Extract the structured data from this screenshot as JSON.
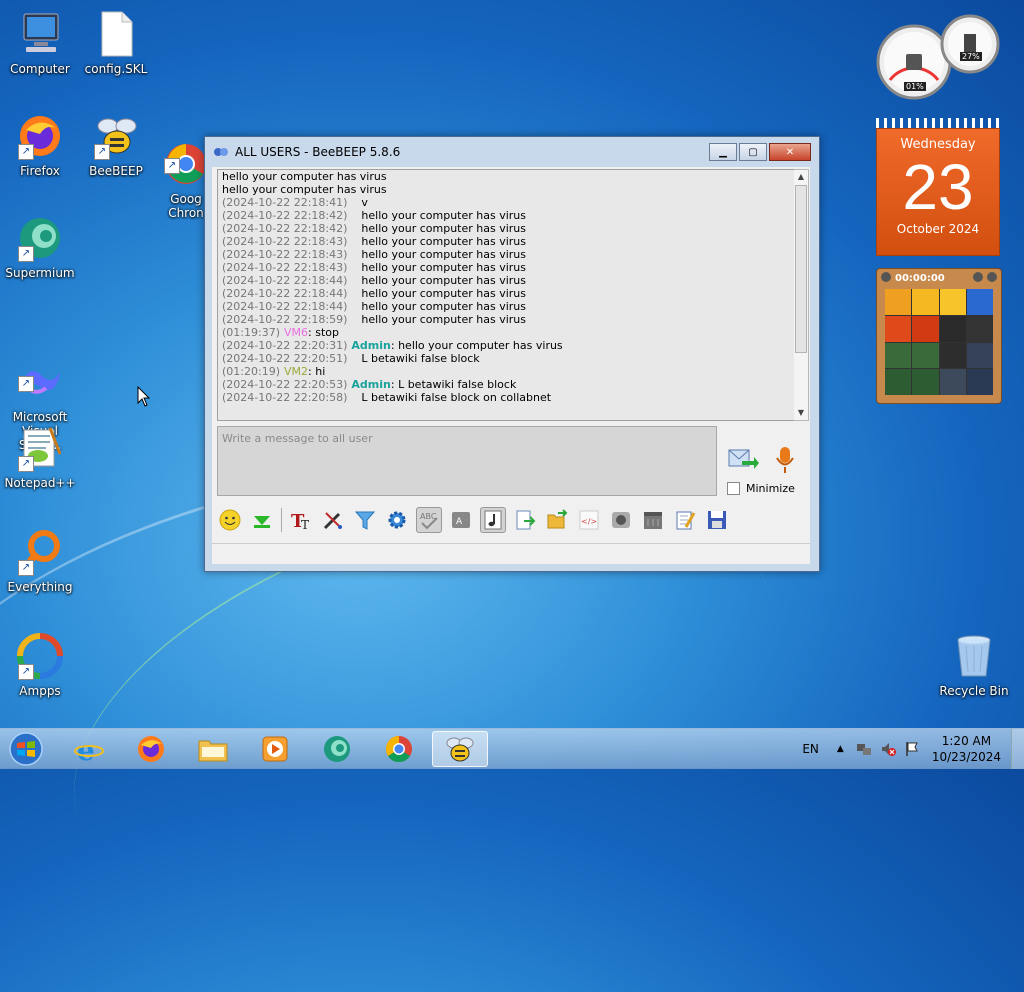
{
  "desktop": {
    "icons": [
      {
        "label": "Computer"
      },
      {
        "label": "config.SKL"
      },
      {
        "label": "Firefox"
      },
      {
        "label": "BeeBEEP"
      },
      {
        "label": "Goog\nChron"
      },
      {
        "label": "Supermium"
      },
      {
        "label": "Microsoft\nVisual Studi..."
      },
      {
        "label": "Notepad++"
      },
      {
        "label": "Everything"
      },
      {
        "label": "Ampps"
      },
      {
        "label": "Recycle Bin"
      }
    ]
  },
  "window": {
    "title": "ALL USERS - BeeBEEP 5.8.6",
    "chat_lines": [
      {
        "ts": "",
        "user": "",
        "text": "hello your computer has virus"
      },
      {
        "ts": "",
        "user": "",
        "text": "hello your computer has virus"
      },
      {
        "ts": "(2024-10-22 22:18:41)",
        "user": "",
        "text": "v"
      },
      {
        "ts": "(2024-10-22 22:18:42)",
        "user": "",
        "text": "hello your computer has virus"
      },
      {
        "ts": "(2024-10-22 22:18:42)",
        "user": "",
        "text": "hello your computer has virus"
      },
      {
        "ts": "(2024-10-22 22:18:43)",
        "user": "",
        "text": "hello your computer has virus"
      },
      {
        "ts": "(2024-10-22 22:18:43)",
        "user": "",
        "text": "hello your computer has virus"
      },
      {
        "ts": "(2024-10-22 22:18:43)",
        "user": "",
        "text": "hello your computer has virus"
      },
      {
        "ts": "(2024-10-22 22:18:44)",
        "user": "",
        "text": "hello your computer has virus"
      },
      {
        "ts": "(2024-10-22 22:18:44)",
        "user": "",
        "text": "hello your computer has virus"
      },
      {
        "ts": "(2024-10-22 22:18:44)",
        "user": "",
        "text": "hello your computer has virus"
      },
      {
        "ts": "(2024-10-22 22:18:59)",
        "user": "",
        "text": "hello your computer has virus"
      },
      {
        "ts": "(01:19:37)",
        "user": "VM6",
        "userclass": "u-vm6",
        "text": ": stop"
      },
      {
        "ts": "(2024-10-22 22:20:31)",
        "user": "Admin",
        "userclass": "u-admin",
        "text": ": hello your computer has virus"
      },
      {
        "ts": "(2024-10-22 22:20:51)",
        "user": "",
        "text": "L betawiki false block"
      },
      {
        "ts": "(01:20:19)",
        "user": "VM2",
        "userclass": "u-vm2",
        "text": ": hi"
      },
      {
        "ts": "(2024-10-22 22:20:53)",
        "user": "Admin",
        "userclass": "u-admin",
        "text": ": L betawiki false block"
      },
      {
        "ts": "(2024-10-22 22:20:58)",
        "user": "",
        "text": "L betawiki false block on collabnet"
      }
    ],
    "input_placeholder": "Write a message to all user",
    "minimize_label": "Minimize",
    "scroll_position": 0.72
  },
  "gadgets": {
    "meter": {
      "cpu": "01%",
      "memory": "27%"
    },
    "calendar": {
      "weekday": "Wednesday",
      "day": "23",
      "month_year": "October 2024"
    },
    "puzzle": {
      "timer": "00:00:00"
    }
  },
  "taskbar": {
    "language": "EN",
    "time": "1:20 AM",
    "date": "10/23/2024"
  }
}
